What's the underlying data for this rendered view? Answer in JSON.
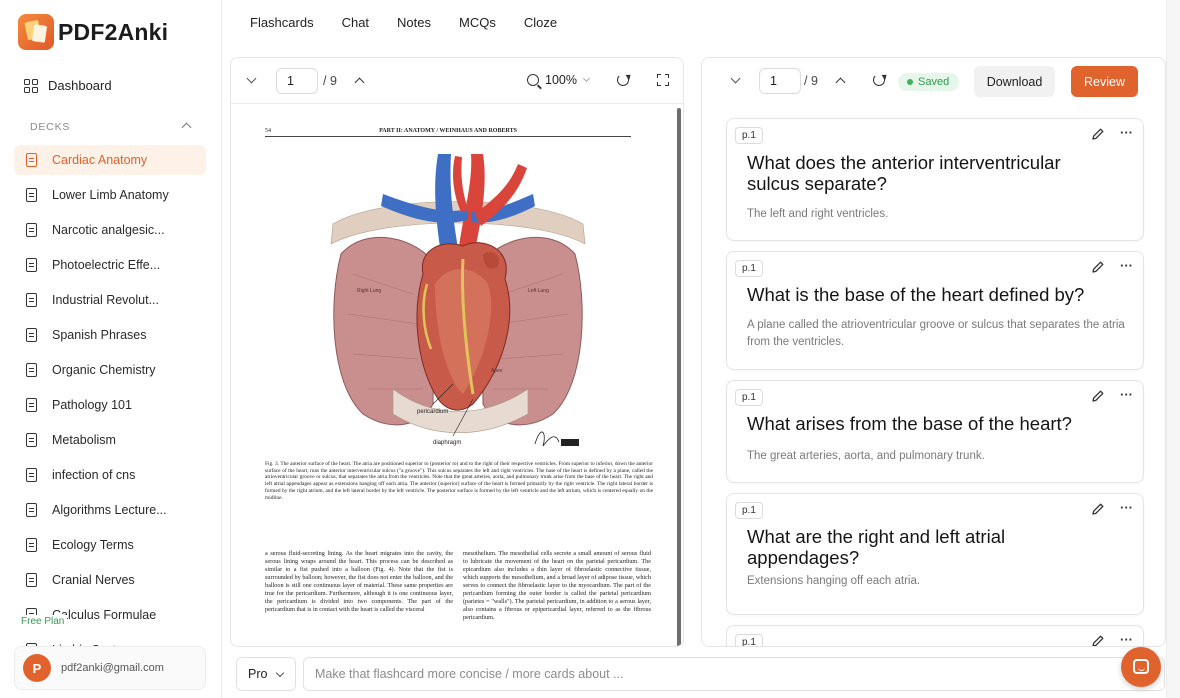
{
  "app": {
    "name": "PDF2Anki"
  },
  "sidebar": {
    "dashboard_label": "Dashboard",
    "decks_heading": "DECKS",
    "decks": [
      {
        "label": "Cardiac Anatomy",
        "active": true
      },
      {
        "label": "Lower Limb Anatomy"
      },
      {
        "label": "Narcotic analgesic..."
      },
      {
        "label": "Photoelectric Effe..."
      },
      {
        "label": "Industrial Revolut..."
      },
      {
        "label": "Spanish Phrases"
      },
      {
        "label": "Organic Chemistry"
      },
      {
        "label": "Pathology 101"
      },
      {
        "label": "Metabolism"
      },
      {
        "label": "infection of cns"
      },
      {
        "label": "Algorithms Lecture..."
      },
      {
        "label": "Ecology Terms"
      },
      {
        "label": "Cranial Nerves"
      },
      {
        "label": "Calculus Formulae"
      },
      {
        "label": "Limbic System"
      }
    ],
    "plan_label": "Free Plan",
    "user": {
      "initial": "P",
      "email": "pdf2anki@gmail.com"
    }
  },
  "tabs": [
    "Flashcards",
    "Chat",
    "Notes",
    "MCQs",
    "Cloze"
  ],
  "pdf_viewer": {
    "page": "1",
    "total": "/ 9",
    "zoom": "100%",
    "document": {
      "page_number": "54",
      "running_head": "PART II: ANATOMY / WEINHAUS AND ROBERTS",
      "figure_labels": {
        "left_lung": "Left Lung",
        "right_lung": "Right Lung",
        "pericardium": "pericardium",
        "diaphragm": "diaphragm",
        "apex": "Apex"
      },
      "caption": "Fig. 3. The anterior surface of the heart. The atria are positioned superior to (posterior to) and to the right of their respective ventricles. From superior to inferior, down the anterior surface of the heart, runs the anterior interventricular sulcus (\"a groove\"). This sulcus separates the left and right ventricles. The base of the heart is defined by a plane, called the atrioventricular groove or sulcus, that separates the atria from the ventricles. Note that the great arteries, aorta, and pulmonary trunk arise from the base of the heart. The right and left atrial appendages appear as extensions hanging off each atria. The anterior (superior) surface of the heart is formed primarily by the right ventricle. The right lateral border is formed by the right atrium, and the left lateral border by the left ventricle. The posterior surface is formed by the left ventricle and the left atrium, which is centered equally on the midline.",
      "col_left": "a serous fluid-secreting lining. As the heart migrates into the cavity, the serous lining wraps around the heart. This process can be described as similar to a fist pushed into a balloon (Fig. 4). Note that the fist is surrounded by balloon; however, the fist does not enter the balloon, and the balloon is still one continuous layer of material. These same properties are true for the pericardium. Furthermore, although it is one continuous layer, the pericardium is divided into two components. The part of the pericardium that is in contact with the heart is called the visceral",
      "col_right": "mesothelium. The mesothelial cells secrete a small amount of serous fluid to lubricate the movement of the heart on the parietal pericardium. The epicardium also includes a thin layer of fibroelastic connective tissue, which supports the mesothelium, and a broad layer of adipose tissue, which serves to connect the fibroelastic layer to the myocardium. The part of the pericardium forming the outer border is called the parietal pericardium (parietes = \"walls\"). The parietal pericardium, in addition to a serous layer, also contains a fibrous or epipericardial layer, referred to as the fibrous pericardium."
    }
  },
  "flashcards": {
    "page": "1",
    "total": "/ 9",
    "saved_label": "Saved",
    "download_label": "Download",
    "review_label": "Review",
    "cards": [
      {
        "tag": "p.1",
        "question": "What does the anterior interventricular sulcus separate?",
        "answer": "The left and right ventricles."
      },
      {
        "tag": "p.1",
        "question": "What is the base of the heart defined by?",
        "answer": "A plane called the atrioventricular groove or sulcus that separates the atria from the ventricles."
      },
      {
        "tag": "p.1",
        "question": "What arises from the base of the heart?",
        "answer": "The great arteries, aorta, and pulmonary trunk."
      },
      {
        "tag": "p.1",
        "question": "What are the right and left atrial appendages?",
        "answer": "Extensions hanging off each atria."
      },
      {
        "tag": "p.1",
        "question": "",
        "answer": ""
      }
    ]
  },
  "chat_bar": {
    "model": "Pro",
    "placeholder": "Make that flashcard more concise / more cards about ..."
  },
  "colors": {
    "accent": "#e0622c",
    "saved_green": "#2e9a4a",
    "active_bg": "#fdf1e8"
  }
}
